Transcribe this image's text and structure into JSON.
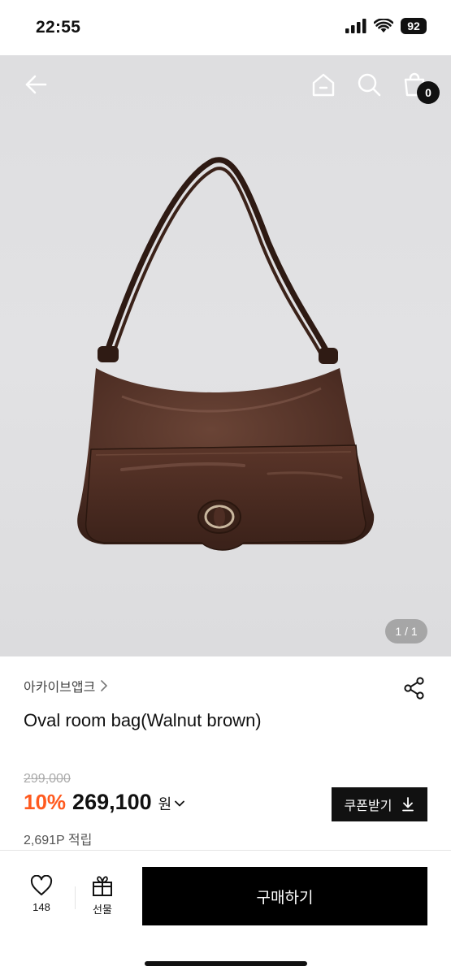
{
  "status": {
    "time": "22:55",
    "battery": "92"
  },
  "nav": {
    "cart_count": "0"
  },
  "product": {
    "image_counter": "1 / 1",
    "brand": "아카이브앱크",
    "name": "Oval room bag(Walnut brown)",
    "original_price": "299,000",
    "discount": "10%",
    "price": "269,100",
    "currency": "원",
    "points": "2,691P 적립"
  },
  "actions": {
    "coupon_label": "쿠폰받기",
    "wish_count": "148",
    "gift_label": "선물",
    "buy_label": "구매하기"
  },
  "colors": {
    "accent_discount": "#ff5a1f",
    "primary_button": "#000000",
    "bag_color": "#4a2a20"
  }
}
